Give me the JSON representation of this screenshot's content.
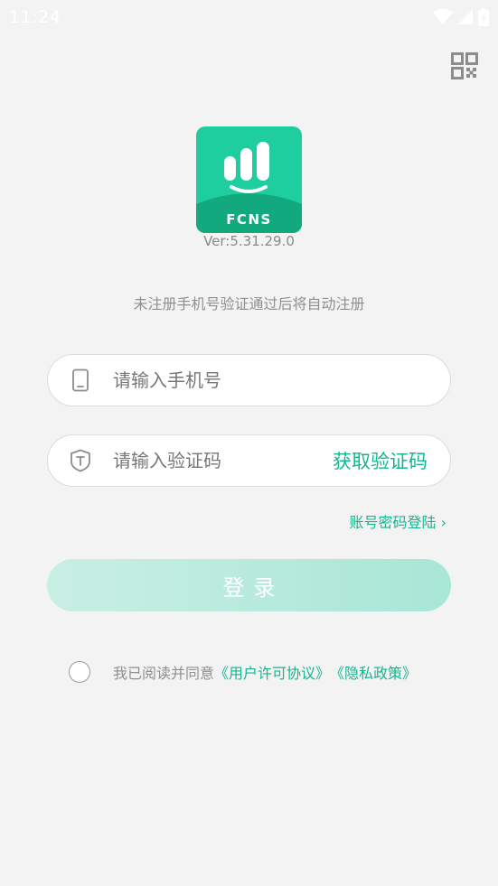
{
  "status_bar": {
    "time": "11:24"
  },
  "logo": {
    "brand": "FCNS"
  },
  "version": "Ver:5.31.29.0",
  "hint": "未注册手机号验证通过后将自动注册",
  "phone": {
    "placeholder": "请输入手机号",
    "value": ""
  },
  "code": {
    "placeholder": "请输入验证码",
    "value": "",
    "get_code_label": "获取验证码"
  },
  "password_login": "账号密码登陆 ›",
  "login_label": "登录",
  "agreement": {
    "prefix": "我已阅读并同意",
    "user_agreement": "《用户许可协议》",
    "privacy_policy": "《隐私政策》"
  },
  "colors": {
    "accent": "#15b58f",
    "logo_green": "#1fce9f",
    "background": "#f3f3f3"
  }
}
